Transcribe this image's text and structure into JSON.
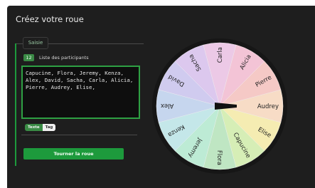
{
  "app": {
    "title": "Créez votre roue"
  },
  "section": {
    "tab_label": "Saisie"
  },
  "participants": {
    "count": "12",
    "label": "Liste des participants",
    "text": "Capucine, Flora, Jeremy, Kenza,\nAlex, David, Sacha, Carla, Alicia,\nPierre, Audrey, Elise,"
  },
  "mode_toggle": {
    "text_label": "Texte",
    "tag_label": "Tag",
    "selected": "Texte"
  },
  "spin_button": {
    "label": "Tourner la roue"
  },
  "wheel": {
    "names": [
      "Audrey",
      "Elise",
      "Capucine",
      "Flora",
      "Jeremy",
      "Kenza",
      "Alex",
      "David",
      "Sacha",
      "Carla",
      "Alicia",
      "Pierre"
    ],
    "colors": [
      "#f7dcc6",
      "#f5ecb2",
      "#d6eeb6",
      "#bfe6c3",
      "#bdebd5",
      "#c4e7e9",
      "#c6d6ee",
      "#d0cbef",
      "#dcc8ee",
      "#ecc9e6",
      "#f3c4d6",
      "#f5c9c6"
    ],
    "ring_color": "#161616",
    "pointer_color": "#111111"
  }
}
